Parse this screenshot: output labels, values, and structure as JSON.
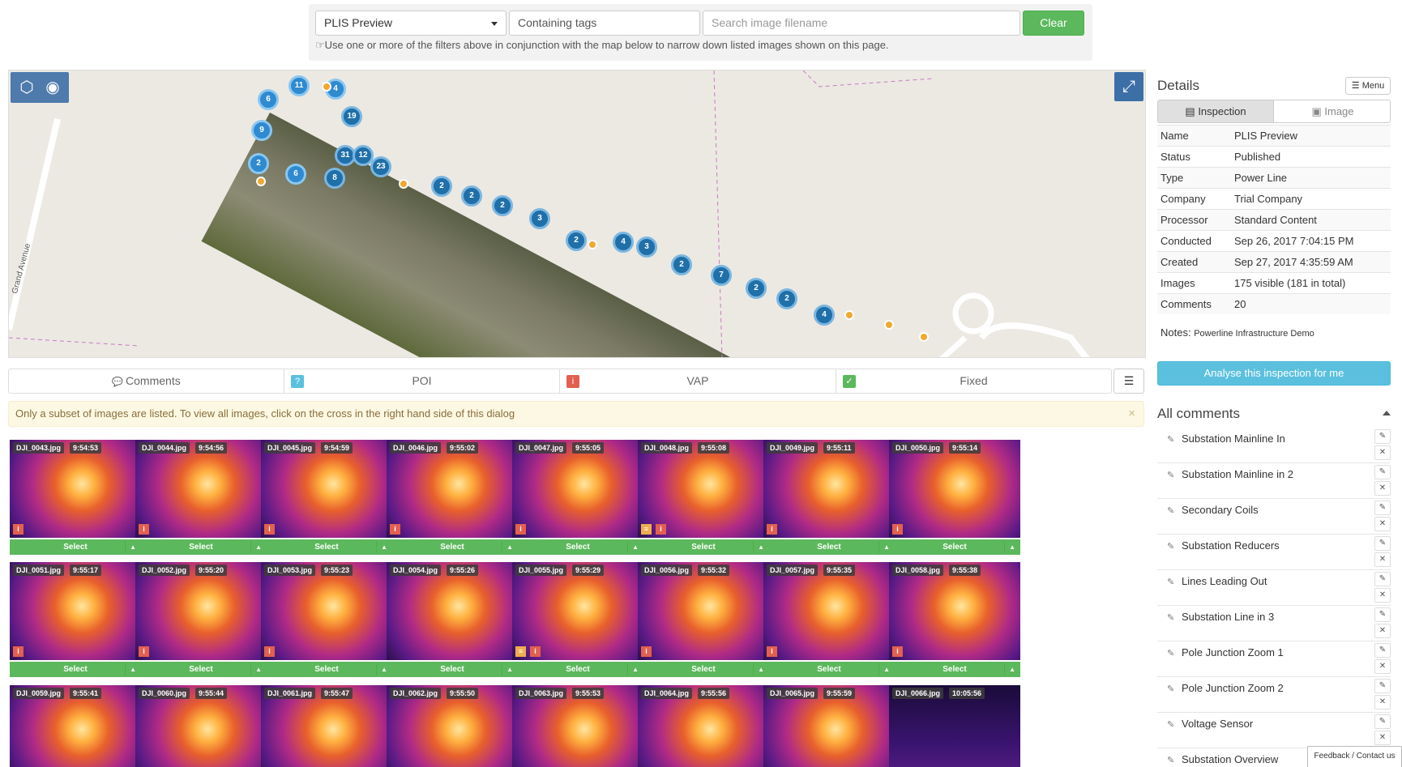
{
  "filters": {
    "inspection_select": "PLIS Preview",
    "tags_placeholder": "Containing tags",
    "filename_placeholder": "Search image filename",
    "clear_label": "Clear",
    "hint": "Use one or more of the filters above in conjunction with the map below to narrow down listed images shown on this page."
  },
  "map": {
    "street_label": "Grand Avenue",
    "clusters": [
      "6",
      "11",
      "4",
      "19",
      "9",
      "31",
      "12",
      "23",
      "2",
      "6",
      "8",
      "2",
      "2",
      "2",
      "3",
      "2",
      "4",
      "3",
      "2",
      "7",
      "2",
      "2",
      "4"
    ]
  },
  "tabs": [
    {
      "label": "Comments",
      "icon": "comments-icon"
    },
    {
      "label": "POI",
      "icon": "question-icon",
      "color": "#5bc0de"
    },
    {
      "label": "VAP",
      "icon": "vap-icon",
      "color": "#e2604f"
    },
    {
      "label": "Fixed",
      "icon": "check-icon",
      "color": "#5cb85c"
    }
  ],
  "alert": "Only a subset of images are listed. To view all images, click on the cross in the right hand side of this dialog",
  "images": [
    {
      "name": "DJI_0043.jpg",
      "time": "9:54:53"
    },
    {
      "name": "DJI_0044.jpg",
      "time": "9:54:56"
    },
    {
      "name": "DJI_0045.jpg",
      "time": "9:54:59"
    },
    {
      "name": "DJI_0046.jpg",
      "time": "9:55:02"
    },
    {
      "name": "DJI_0047.jpg",
      "time": "9:55:05"
    },
    {
      "name": "DJI_0048.jpg",
      "time": "9:55:08"
    },
    {
      "name": "DJI_0049.jpg",
      "time": "9:55:11"
    },
    {
      "name": "DJI_0050.jpg",
      "time": "9:55:14"
    },
    {
      "name": "DJI_0051.jpg",
      "time": "9:55:17"
    },
    {
      "name": "DJI_0052.jpg",
      "time": "9:55:20"
    },
    {
      "name": "DJI_0053.jpg",
      "time": "9:55:23"
    },
    {
      "name": "DJI_0054.jpg",
      "time": "9:55:26"
    },
    {
      "name": "DJI_0055.jpg",
      "time": "9:55:29"
    },
    {
      "name": "DJI_0056.jpg",
      "time": "9:55:32"
    },
    {
      "name": "DJI_0057.jpg",
      "time": "9:55:35"
    },
    {
      "name": "DJI_0058.jpg",
      "time": "9:55:38"
    },
    {
      "name": "DJI_0059.jpg",
      "time": "9:55:41"
    },
    {
      "name": "DJI_0060.jpg",
      "time": "9:55:44"
    },
    {
      "name": "DJI_0061.jpg",
      "time": "9:55:47"
    },
    {
      "name": "DJI_0062.jpg",
      "time": "9:55:50"
    },
    {
      "name": "DJI_0063.jpg",
      "time": "9:55:53"
    },
    {
      "name": "DJI_0064.jpg",
      "time": "9:55:56"
    },
    {
      "name": "DJI_0065.jpg",
      "time": "9:55:59"
    },
    {
      "name": "DJI_0066.jpg",
      "time": "10:05:56"
    }
  ],
  "select_label": "Select",
  "details": {
    "title": "Details",
    "menu_label": "Menu",
    "tab_inspection": "Inspection",
    "tab_image": "Image",
    "rows": [
      {
        "k": "Name",
        "v": "PLIS Preview"
      },
      {
        "k": "Status",
        "v": "Published"
      },
      {
        "k": "Type",
        "v": "Power Line"
      },
      {
        "k": "Company",
        "v": "Trial Company"
      },
      {
        "k": "Processor",
        "v": "Standard Content"
      },
      {
        "k": "Conducted",
        "v": "Sep 26, 2017 7:04:15 PM"
      },
      {
        "k": "Created",
        "v": "Sep 27, 2017 4:35:59 AM"
      },
      {
        "k": "Images",
        "v": "175 visible (181 in total)"
      },
      {
        "k": "Comments",
        "v": "20"
      }
    ],
    "notes_label": "Notes:",
    "notes_value": "Powerline Infrastructure Demo",
    "analyse_label": "Analyse this inspection for me"
  },
  "comments": {
    "title": "All comments",
    "items": [
      "Substation Mainline In",
      "Substation Mainline in 2",
      "Secondary Coils",
      "Substation Reducers",
      "Lines Leading Out",
      "Substation Line in 3",
      "Pole Junction Zoom 1",
      "Pole Junction Zoom 2",
      "Voltage Sensor",
      "Substation Overview"
    ]
  },
  "feedback": "Feedback / Contact us",
  "colors": {
    "green": "#5cb85c",
    "blue": "#5bc0de",
    "map_marker": "#2f8ad0"
  }
}
